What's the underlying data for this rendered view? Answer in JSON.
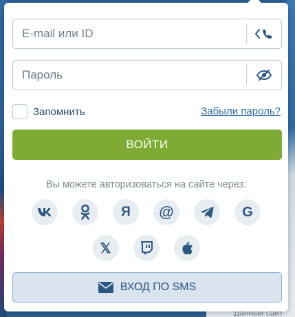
{
  "background": {
    "bottom_text": "Данный сайт"
  },
  "login_form": {
    "email_placeholder": "E-mail или ID",
    "password_placeholder": "Пароль",
    "remember_label": "Запомнить",
    "forgot_link": "Забыли пароль?",
    "login_button": "ВОЙТИ",
    "social_caption": "Вы можете авторизоваться на сайте через:",
    "social_providers": [
      {
        "name": "vk",
        "label": "vk"
      },
      {
        "name": "odnoklassniki",
        "label": "ok"
      },
      {
        "name": "yandex",
        "label": "Я"
      },
      {
        "name": "mail-ru",
        "label": "@"
      },
      {
        "name": "telegram",
        "label": "telegram"
      },
      {
        "name": "google",
        "label": "G"
      },
      {
        "name": "x",
        "label": "𝕏"
      },
      {
        "name": "twitch",
        "label": "twitch"
      },
      {
        "name": "apple",
        "label": "apple"
      }
    ],
    "sms_button": "ВХОД ПО SMS"
  },
  "colors": {
    "primary_blue": "#2b5783",
    "login_green": "#7dab33",
    "link_blue": "#2b6aa6",
    "social_bg": "#e8edf2"
  }
}
